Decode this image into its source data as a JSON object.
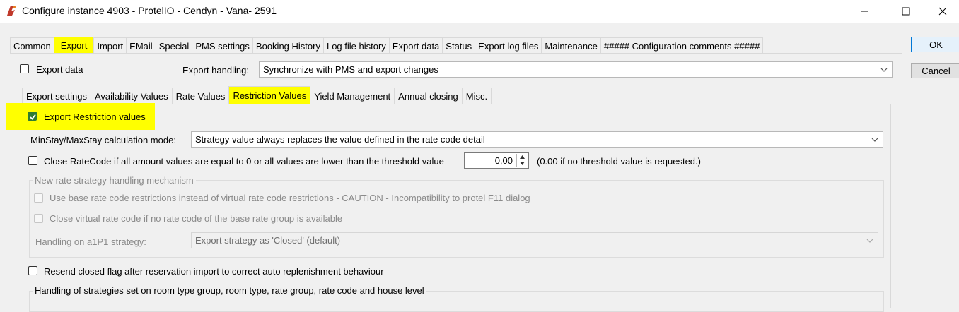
{
  "window": {
    "title": "Configure instance 4903 - ProtelIO - Cendyn - Vana- 2591",
    "controls": [
      "minimize-icon",
      "maximize-icon",
      "close-icon"
    ]
  },
  "tabs": [
    {
      "label": "Common",
      "active": false
    },
    {
      "label": "Export",
      "active": true
    },
    {
      "label": "Import",
      "active": false
    },
    {
      "label": "EMail",
      "active": false
    },
    {
      "label": "Special",
      "active": false
    },
    {
      "label": "PMS settings",
      "active": false
    },
    {
      "label": "Booking History",
      "active": false
    },
    {
      "label": "Log file history",
      "active": false
    },
    {
      "label": "Export data",
      "active": false
    },
    {
      "label": "Status",
      "active": false
    },
    {
      "label": "Export log files",
      "active": false
    },
    {
      "label": "Maintenance",
      "active": false
    },
    {
      "label": "##### Configuration comments #####",
      "active": false
    }
  ],
  "buttons": {
    "ok": "OK",
    "cancel": "Cancel"
  },
  "export_data": {
    "label": "Export data",
    "checked": false
  },
  "export_handling": {
    "label": "Export handling:",
    "value": "Synchronize with PMS and export changes"
  },
  "subtabs": [
    {
      "label": "Export settings",
      "active": false
    },
    {
      "label": "Availability Values",
      "active": false
    },
    {
      "label": "Rate Values",
      "active": false
    },
    {
      "label": "Restriction Values",
      "active": true
    },
    {
      "label": "Yield Management",
      "active": false
    },
    {
      "label": "Annual closing",
      "active": false
    },
    {
      "label": "Misc.",
      "active": false
    }
  ],
  "restriction": {
    "export_values": {
      "label": "Export Restriction values",
      "checked": true
    },
    "minstay_mode": {
      "label": "MinStay/MaxStay calculation mode:",
      "value": "Strategy value always replaces the value defined in the rate code detail"
    },
    "close_ratecode": {
      "label": "Close RateCode if all amount values are equal to 0 or all values are lower than the threshold value",
      "checked": false
    },
    "threshold": {
      "value": "0,00",
      "hint": "(0.00 if no threshold value is requested.)"
    },
    "new_mechanism": {
      "legend": "New rate strategy handling mechanism",
      "use_base": "Use base rate code restrictions instead of virtual rate code restrictions - CAUTION - Incompatibility to protel F11 dialog",
      "close_virtual": "Close virtual rate code if no rate code of the base rate group is available",
      "a1p1_label": "Handling on a1P1 strategy:",
      "a1p1_value": "Export strategy as 'Closed' (default)"
    },
    "resend_closed": {
      "label": "Resend closed flag after reservation import to correct auto replenishment behaviour",
      "checked": false
    },
    "handling_strategies_legend": "Handling of strategies set on room type group, room type, rate group, rate code and house level"
  },
  "colors": {
    "highlight": "#ffff00",
    "check_green": "#2e7d32"
  }
}
